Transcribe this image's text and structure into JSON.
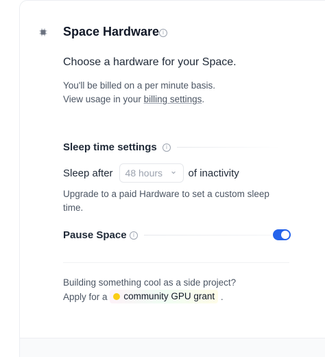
{
  "header": {
    "title": "Space Hardware",
    "subtitle": "Choose a hardware for your Space.",
    "billing_line1": "You'll be billed on a per minute basis.",
    "billing_prefix": "View usage in your ",
    "billing_link": "billing settings",
    "billing_suffix": "."
  },
  "sleep": {
    "heading": "Sleep time settings",
    "label_before": "Sleep after",
    "select_value": "48 hours",
    "label_after": "of inactivity",
    "upgrade_note": "Upgrade to a paid Hardware to set a custom sleep time."
  },
  "pause": {
    "heading": "Pause Space",
    "toggle_on": true
  },
  "grant": {
    "line1": "Building something cool as a side project?",
    "prefix": "Apply for a",
    "link": "community GPU grant",
    "suffix": "."
  },
  "icons": {
    "info_glyph": "i",
    "chevron_glyph": "⌄"
  },
  "colors": {
    "accent": "#2563eb",
    "text": "#1f2937",
    "muted": "#4b5563"
  }
}
